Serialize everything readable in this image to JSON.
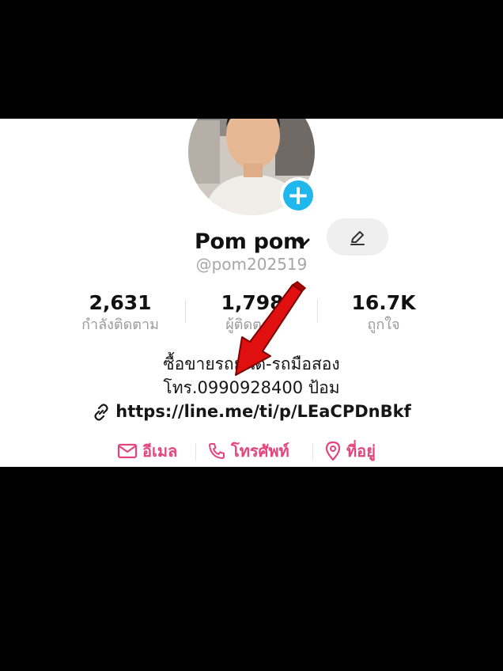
{
  "profile": {
    "display_name": "Pom pom",
    "handle": "@pom202519"
  },
  "stats": [
    {
      "value": "2,631",
      "label": "กำลังติดตาม"
    },
    {
      "value": "1,798",
      "label": "ผู้ติดตาม"
    },
    {
      "value": "16.7K",
      "label": "ถูกใจ"
    }
  ],
  "bio": {
    "line1": "ซื้อขายรถยนต์-รถมือสอง",
    "line2": "โทร.0990928400 ป้อม"
  },
  "link": {
    "url": "https://line.me/ti/p/LEaCPDnBkf"
  },
  "actions": {
    "email_label": "อีเมล",
    "phone_label": "โทรศัพท์",
    "address_label": "ที่อยู่"
  },
  "colors": {
    "accent": "#e4457a",
    "badge": "#20b7ec",
    "arrow": "#e01010"
  },
  "icons": [
    "plus-icon",
    "chevron-down-icon",
    "pencil-icon",
    "link-icon",
    "mail-icon",
    "phone-icon",
    "location-pin-icon"
  ]
}
